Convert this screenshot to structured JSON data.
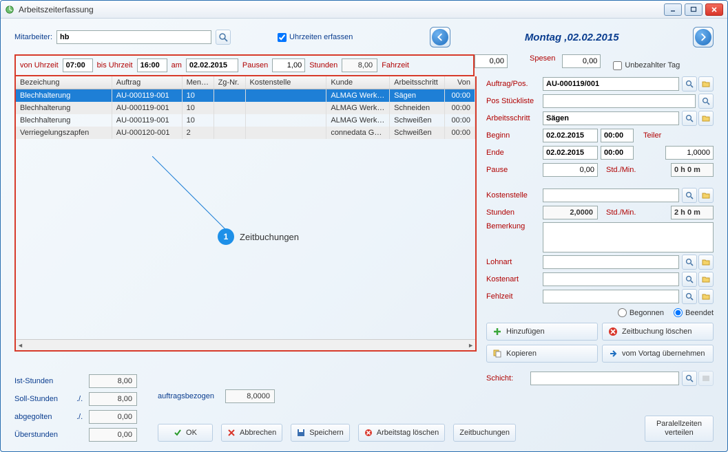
{
  "window": {
    "title": "Arbeitszeiterfassung"
  },
  "top": {
    "mitarbeiter_label": "Mitarbeiter:",
    "mitarbeiter_value": "hb",
    "uhrzeiten_label": "Uhrzeiten erfassen",
    "date_header": "Montag ,02.02.2015"
  },
  "filter": {
    "von_label": "von Uhrzeit",
    "von_value": "07:00",
    "bis_label": "bis Uhrzeit",
    "bis_value": "16:00",
    "am_label": "am",
    "am_value": "02.02.2015",
    "pausen_label": "Pausen",
    "pausen_value": "1,00",
    "stunden_label": "Stunden",
    "stunden_value": "8,00",
    "fahrzeit_label": "Fahrzeit",
    "fahrzeit_value": "0,00",
    "spesen_label": "Spesen",
    "spesen_value": "0,00",
    "unbezahlter_label": "Unbezahlter Tag"
  },
  "grid": {
    "headers": [
      "Bezeichung",
      "Auftrag",
      "Menge",
      "Zg-Nr.",
      "Kostenstelle",
      "Kunde",
      "Arbeitsschritt",
      "Von"
    ],
    "rows": [
      {
        "bez": "Blechhalterung",
        "auf": "AU-000119-001",
        "menge": "10",
        "zg": "",
        "ks": "",
        "kunde": "ALMAG Werkz...",
        "arb": "Sägen",
        "von": "00:00"
      },
      {
        "bez": "Blechhalterung",
        "auf": "AU-000119-001",
        "menge": "10",
        "zg": "",
        "ks": "",
        "kunde": "ALMAG Werkz...",
        "arb": "Schneiden",
        "von": "00:00"
      },
      {
        "bez": "Blechhalterung",
        "auf": "AU-000119-001",
        "menge": "10",
        "zg": "",
        "ks": "",
        "kunde": "ALMAG Werkz...",
        "arb": "Schweißen",
        "von": "00:00"
      },
      {
        "bez": "Verriegelungszapfen",
        "auf": "AU-000120-001",
        "menge": "2",
        "zg": "",
        "ks": "",
        "kunde": "connedata GmbH",
        "arb": "Schweißen",
        "von": "00:00"
      }
    ]
  },
  "callout": {
    "num": "1",
    "text": "Zeitbuchungen"
  },
  "detail": {
    "auftrag_label": "Auftrag/Pos.",
    "auftrag_value": "AU-000119/001",
    "posstk_label": "Pos Stückliste",
    "posstk_value": "",
    "arbschritt_label": "Arbeitsschritt",
    "arbschritt_value": "Sägen",
    "beginn_label": "Beginn",
    "beginn_date": "02.02.2015",
    "beginn_time": "00:00",
    "teiler_label": "Teiler",
    "teiler_value": "1,0000",
    "ende_label": "Ende",
    "ende_date": "02.02.2015",
    "ende_time": "00:00",
    "pause_label": "Pause",
    "pause_value": "0,00",
    "stdmin_label": "Std./Min.",
    "pause_hms": "0 h 0 m",
    "kostenstelle_label": "Kostenstelle",
    "kostenstelle_value": "",
    "stunden_label": "Stunden",
    "stunden_value": "2,0000",
    "stunden_hms": "2 h 0 m",
    "bemerkung_label": "Bemerkung",
    "bemerkung_value": "",
    "lohnart_label": "Lohnart",
    "lohnart_value": "",
    "kostenart_label": "Kostenart",
    "kostenart_value": "",
    "fehlzeit_label": "Fehlzeit",
    "fehlzeit_value": "",
    "begonnen_label": "Begonnen",
    "beendet_label": "Beendet",
    "hinzufuegen": "Hinzufügen",
    "loeschen": "Zeitbuchung löschen",
    "kopieren": "Kopieren",
    "vortag": "vom Vortag übernehmen",
    "schicht_label": "Schicht:",
    "schicht_value": ""
  },
  "summary": {
    "ist_label": "Ist-Stunden",
    "ist_value": "8,00",
    "soll_label": "Soll-Stunden",
    "soll_value": "8,00",
    "abg_label": "abgegolten",
    "abg_value": "0,00",
    "ueber_label": "Überstunden",
    "ueber_value": "0,00",
    "dotslash": "./.",
    "auftragsbezogen_label": "auftragsbezogen",
    "auftragsbezogen_value": "8,0000"
  },
  "buttons": {
    "ok": "OK",
    "abbrechen": "Abbrechen",
    "speichern": "Speichern",
    "arbeitstag_loeschen": "Arbeitstag löschen",
    "zeitbuchungen": "Zeitbuchungen",
    "parallel": "Paralellzeiten\nverteilen"
  }
}
